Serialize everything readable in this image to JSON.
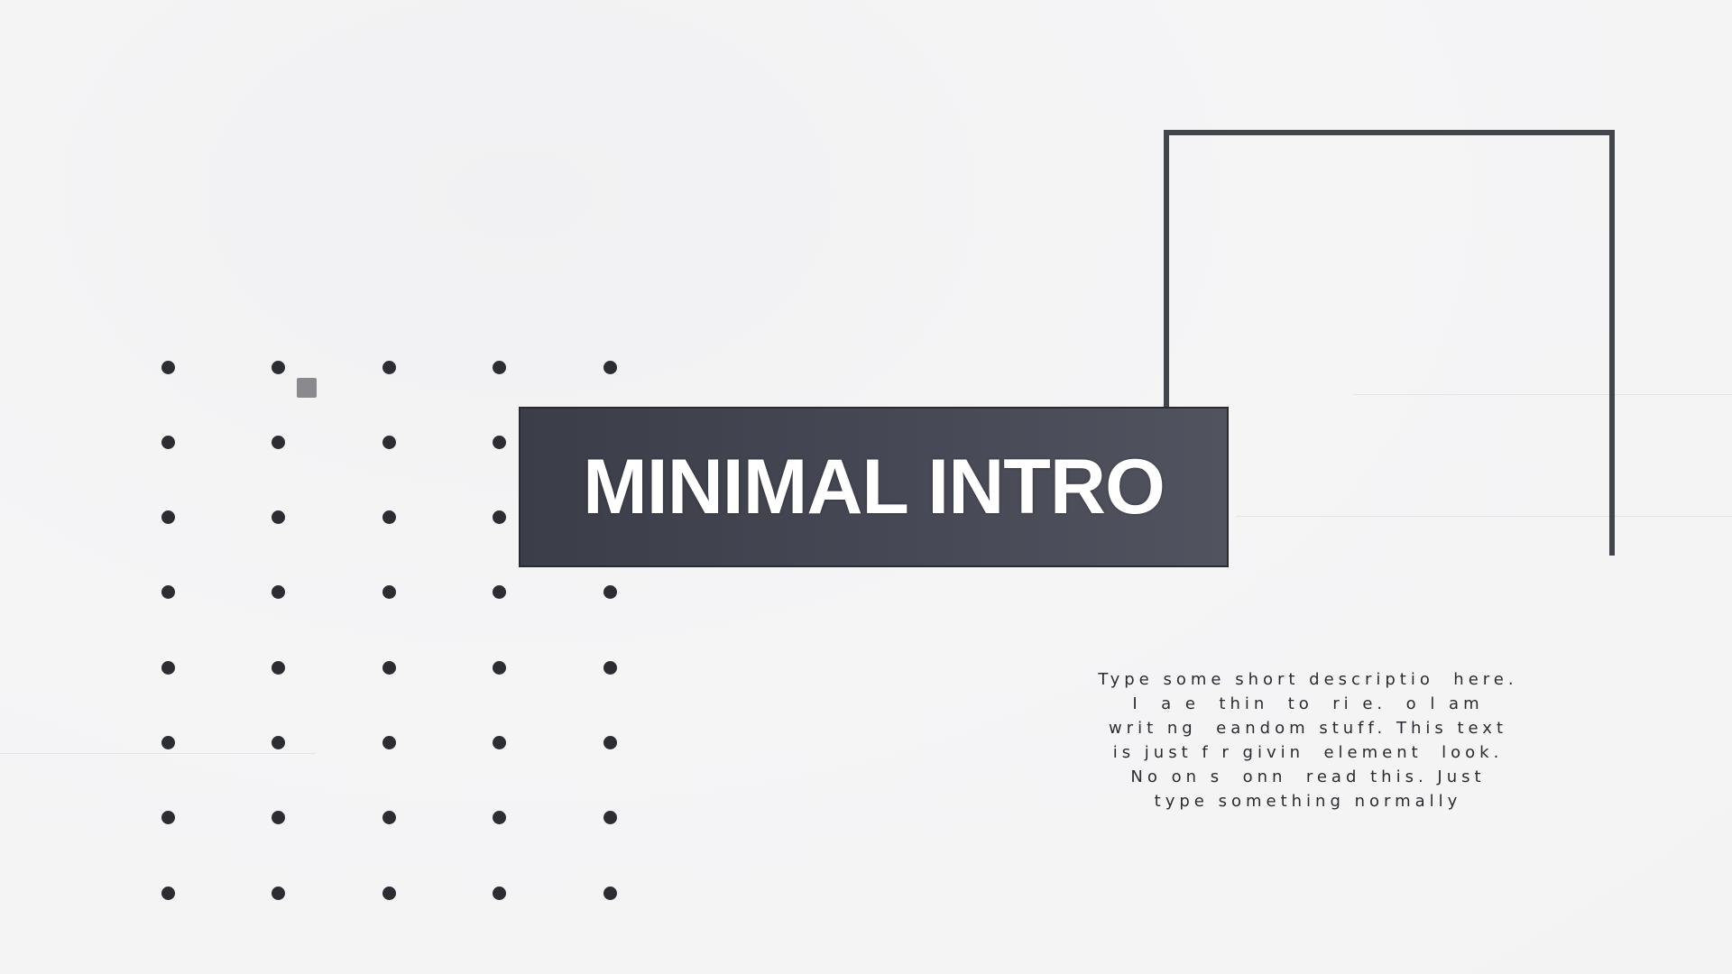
{
  "title": "MINIMAL INTRO",
  "description_lines": [
    "Type some short descriptio  here.",
    "I  a e  thin  to  ri e.  o l am",
    "writ ng  eandom stuff. This text",
    "is just f r givin  element  look.",
    "No on s  onn  read this. Just",
    "type something normally"
  ],
  "colors": {
    "background": "#f4f4f5",
    "dot": "#2c2d33",
    "title_box": "#464955",
    "title_text": "#ffffff",
    "frame": "#3a3c45",
    "accent_square": "#8a8a8e"
  }
}
